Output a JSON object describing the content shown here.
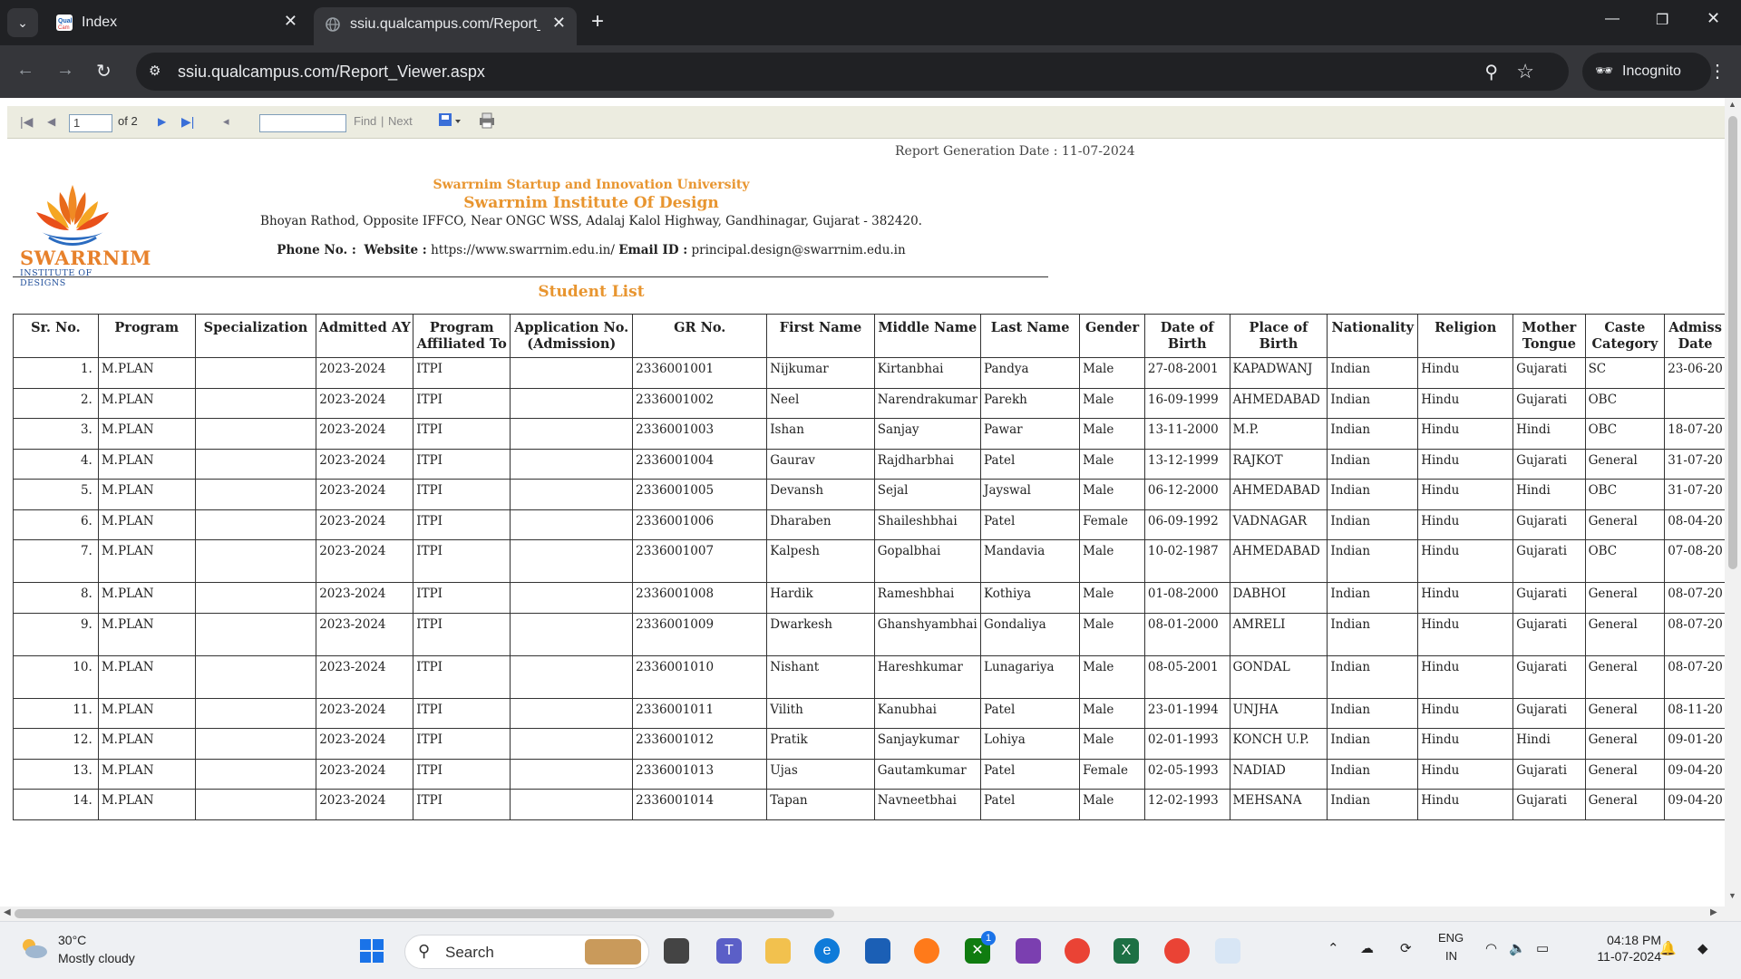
{
  "browser": {
    "tabs": [
      {
        "title": "Index",
        "active": false
      },
      {
        "title": "ssiu.qualcampus.com/Report_Viewer.aspx",
        "active": true
      }
    ],
    "url": "ssiu.qualcampus.com/Report_Viewer.aspx",
    "incognito_label": "Incognito"
  },
  "viewer": {
    "page_current": "1",
    "page_of": "of 2",
    "find_label": "Find",
    "separator": "|",
    "next_label": "Next"
  },
  "report": {
    "generation_date": "Report Generation Date : 11-07-2024",
    "logo_brand": "SWARRNIM",
    "logo_sub": "INSTITUTE OF DESIGNS",
    "university": "Swarrnim Startup and Innovation University",
    "institute": "Swarrnim Institute Of Design",
    "address": "Bhoyan Rathod, Opposite IFFCO, Near ONGC WSS, Adalaj Kalol Highway, Gandhinagar, Gujarat - 382420.",
    "phone_label": "Phone No. :",
    "website_label": "Website :",
    "website": "https://www.swarrnim.edu.in/",
    "email_label": "Email ID :",
    "email": "principal.design@swarrnim.edu.in",
    "list_title": "Student List"
  },
  "table": {
    "columns": [
      "Sr. No.",
      "Program",
      "Specialization",
      "Admitted AY",
      "Program Affiliated To",
      "Application No. (Admission)",
      "GR No.",
      "First Name",
      "Middle Name",
      "Last Name",
      "Gender",
      "Date of Birth",
      "Place of Birth",
      "Nationality",
      "Religion",
      "Mother Tongue",
      "Caste Category",
      "Admiss Date"
    ],
    "rows": [
      [
        "1.",
        "M.PLAN",
        "",
        "2023-2024",
        "ITPI",
        "",
        "2336001001",
        "Nijkumar",
        "Kirtanbhai",
        "Pandya",
        "Male",
        "27-08-2001",
        "KAPADWANJ",
        "Indian",
        "Hindu",
        "Gujarati",
        "SC",
        "23-06-20"
      ],
      [
        "2.",
        "M.PLAN",
        "",
        "2023-2024",
        "ITPI",
        "",
        "2336001002",
        "Neel",
        "Narendrakumar",
        "Parekh",
        "Male",
        "16-09-1999",
        "AHMEDABAD",
        "Indian",
        "Hindu",
        "Gujarati",
        "OBC",
        ""
      ],
      [
        "3.",
        "M.PLAN",
        "",
        "2023-2024",
        "ITPI",
        "",
        "2336001003",
        "Ishan",
        "Sanjay",
        "Pawar",
        "Male",
        "13-11-2000",
        "M.P.",
        "Indian",
        "Hindu",
        "Hindi",
        "OBC",
        "18-07-20"
      ],
      [
        "4.",
        "M.PLAN",
        "",
        "2023-2024",
        "ITPI",
        "",
        "2336001004",
        "Gaurav",
        "Rajdharbhai",
        "Patel",
        "Male",
        "13-12-1999",
        "RAJKOT",
        "Indian",
        "Hindu",
        "Gujarati",
        "General",
        "31-07-20"
      ],
      [
        "5.",
        "M.PLAN",
        "",
        "2023-2024",
        "ITPI",
        "",
        "2336001005",
        "Devansh",
        "Sejal",
        "Jayswal",
        "Male",
        "06-12-2000",
        "AHMEDABAD",
        "Indian",
        "Hindu",
        "Hindi",
        "OBC",
        "31-07-20"
      ],
      [
        "6.",
        "M.PLAN",
        "",
        "2023-2024",
        "ITPI",
        "",
        "2336001006",
        "Dharaben",
        "Shaileshbhai",
        "Patel",
        "Female",
        "06-09-1992",
        "VADNAGAR",
        "Indian",
        "Hindu",
        "Gujarati",
        "General",
        "08-04-20"
      ],
      [
        "7.",
        "M.PLAN",
        "",
        "2023-2024",
        "ITPI",
        "",
        "2336001007",
        "Kalpesh",
        "Gopalbhai",
        "Mandavia",
        "Male",
        "10-02-1987",
        "AHMEDABAD",
        "Indian",
        "Hindu",
        "Gujarati",
        "OBC",
        "07-08-20"
      ],
      [
        "8.",
        "M.PLAN",
        "",
        "2023-2024",
        "ITPI",
        "",
        "2336001008",
        "Hardik",
        "Rameshbhai",
        "Kothiya",
        "Male",
        "01-08-2000",
        "DABHOI",
        "Indian",
        "Hindu",
        "Gujarati",
        "General",
        "08-07-20"
      ],
      [
        "9.",
        "M.PLAN",
        "",
        "2023-2024",
        "ITPI",
        "",
        "2336001009",
        "Dwarkesh",
        "Ghanshyambhai",
        "Gondaliya",
        "Male",
        "08-01-2000",
        "AMRELI",
        "Indian",
        "Hindu",
        "Gujarati",
        "General",
        "08-07-20"
      ],
      [
        "10.",
        "M.PLAN",
        "",
        "2023-2024",
        "ITPI",
        "",
        "2336001010",
        "Nishant",
        "Hareshkumar",
        "Lunagariya",
        "Male",
        "08-05-2001",
        "GONDAL",
        "Indian",
        "Hindu",
        "Gujarati",
        "General",
        "08-07-20"
      ],
      [
        "11.",
        "M.PLAN",
        "",
        "2023-2024",
        "ITPI",
        "",
        "2336001011",
        "Vilith",
        "Kanubhai",
        "Patel",
        "Male",
        "23-01-1994",
        "UNJHA",
        "Indian",
        "Hindu",
        "Gujarati",
        "General",
        "08-11-20"
      ],
      [
        "12.",
        "M.PLAN",
        "",
        "2023-2024",
        "ITPI",
        "",
        "2336001012",
        "Pratik",
        "Sanjaykumar",
        "Lohiya",
        "Male",
        "02-01-1993",
        "KONCH U.P.",
        "Indian",
        "Hindu",
        "Hindi",
        "General",
        "09-01-20"
      ],
      [
        "13.",
        "M.PLAN",
        "",
        "2023-2024",
        "ITPI",
        "",
        "2336001013",
        "Ujas",
        "Gautamkumar",
        "Patel",
        "Female",
        "02-05-1993",
        "NADIAD",
        "Indian",
        "Hindu",
        "Gujarati",
        "General",
        "09-04-20"
      ],
      [
        "14.",
        "M.PLAN",
        "",
        "2023-2024",
        "ITPI",
        "",
        "2336001014",
        "Tapan",
        "Navneetbhai",
        "Patel",
        "Male",
        "12-02-1993",
        "MEHSANA",
        "Indian",
        "Hindu",
        "Gujarati",
        "General",
        "09-04-20"
      ]
    ]
  },
  "taskbar": {
    "temperature": "30°C",
    "weather": "Mostly cloudy",
    "search_label": "Search",
    "language": "ENG",
    "region": "IN",
    "time": "04:18 PM",
    "date": "11-07-2024",
    "xbox_badge": "1"
  },
  "colors": {
    "accent_orange": "#e8952f",
    "chrome_dark": "#202124",
    "chrome_mid": "#35363a",
    "toolbar_bg": "#ecece0"
  }
}
